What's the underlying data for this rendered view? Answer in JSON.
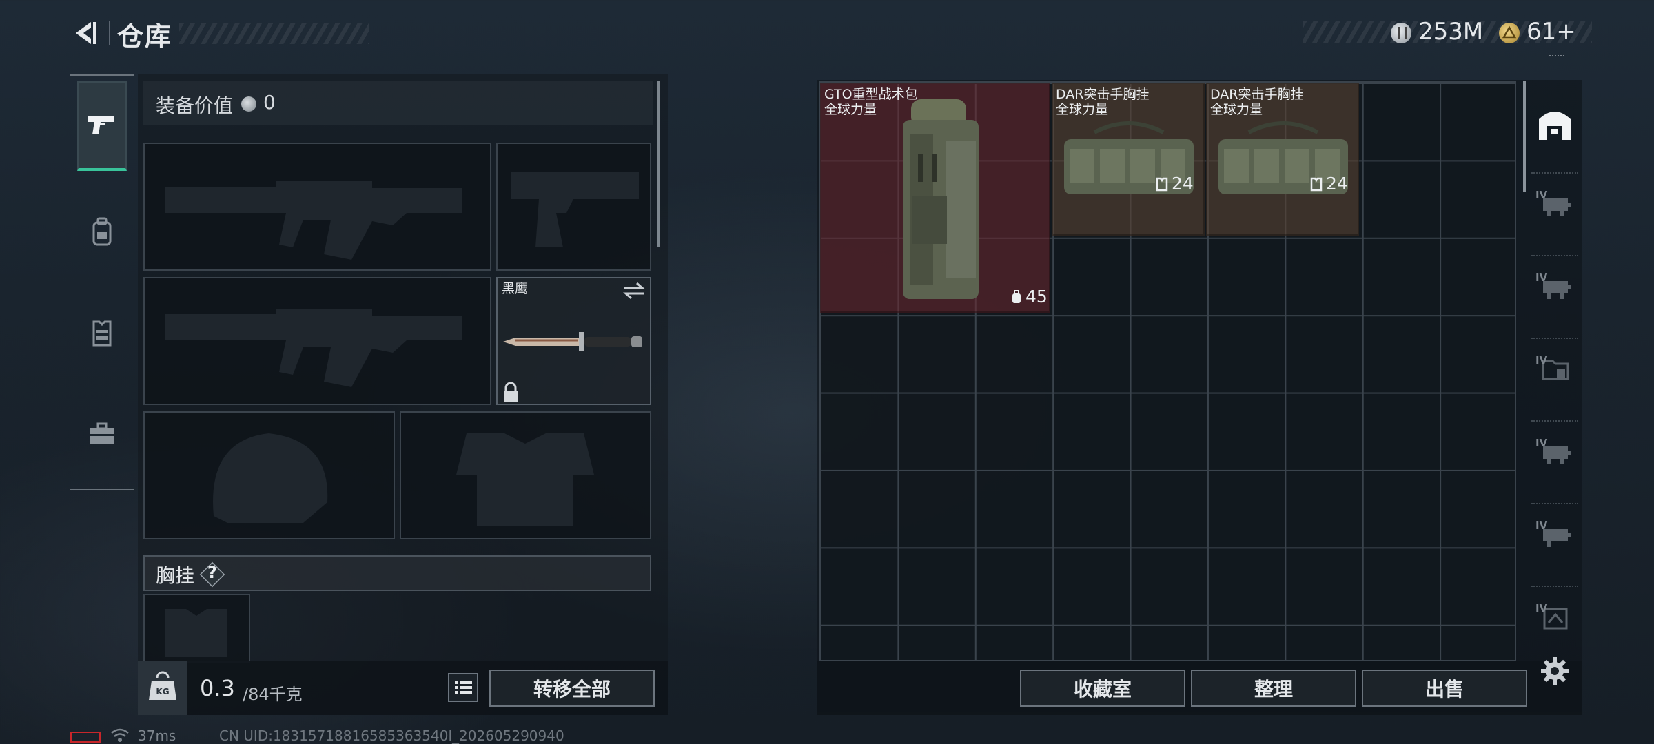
{
  "header": {
    "title": "仓库",
    "currency_silver": "253M",
    "currency_gold": "61+"
  },
  "categories": [
    {
      "icon": "pistol-icon",
      "active": true
    },
    {
      "icon": "backpack-icon",
      "active": false
    },
    {
      "icon": "vest-icon",
      "active": false
    },
    {
      "icon": "toolbox-icon",
      "active": false
    }
  ],
  "loadout": {
    "value_label": "装备价值",
    "value_amount": "0",
    "melee_name": "黑鹰",
    "rig_label": "胸挂",
    "rig_help": "?",
    "weight_current": "0.3",
    "weight_max": "/84千克",
    "transfer_all_label": "转移全部"
  },
  "storage": {
    "items": [
      {
        "name": "GTO重型战术包",
        "subtitle": "全球力量",
        "count": "45",
        "rarity_color": "#6e2830"
      },
      {
        "name": "DAR突击手胸挂",
        "subtitle": "全球力量",
        "count": "24",
        "rarity_color": "#584232"
      },
      {
        "name": "DAR突击手胸挂",
        "subtitle": "全球力量",
        "count": "24",
        "rarity_color": "#584232"
      }
    ],
    "side_tabs": [
      "IV",
      "IV",
      "IV",
      "IV",
      "IV",
      "IV"
    ],
    "collection_label": "收藏室",
    "sort_label": "整理",
    "sell_label": "出售"
  },
  "status": {
    "ping": "37ms",
    "uid": "CN UID:18315718816585363540l_202605290940"
  },
  "colors": {
    "accent": "#39c39a",
    "battery_warning": "#c8262a"
  }
}
